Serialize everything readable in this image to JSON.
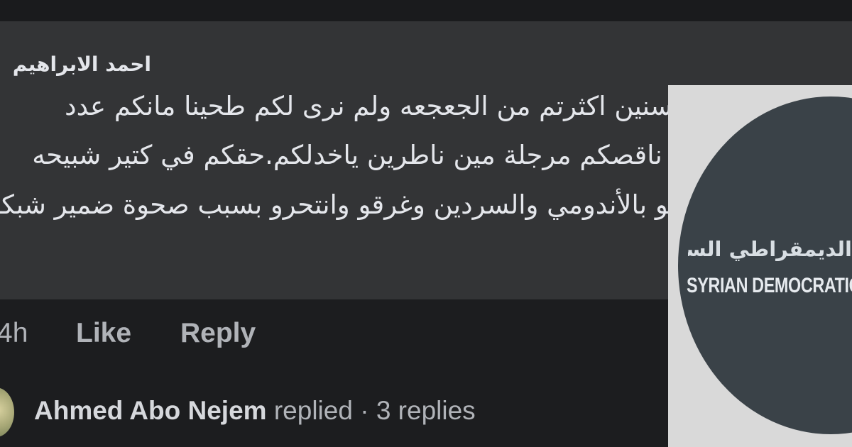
{
  "comment": {
    "author": "احمد الابراهيم",
    "lines": [
      "يا مسنين اكثرتم من الجعجعه ولم نرى لكم طحينا  مانكم عدد",
      "بس ناقصكم مرجلة مين ناطرين ياخدلكم.حقكم في كتير شبيحه",
      "شبعو بالأندومي والسردين  وغرقو وانتحرو بسبب صحوة ضمير شبكم"
    ],
    "time": "4h",
    "like_label": "Like",
    "reply_label": "Reply"
  },
  "replies": {
    "name": "Ahmed Abo Nejem",
    "action": " replied",
    "separator": " · ",
    "count_label": "3 replies"
  },
  "photo": {
    "arabic_text": "الديمقراطي السوري",
    "english_text": "SYRIAN DEMOCRATIC"
  }
}
